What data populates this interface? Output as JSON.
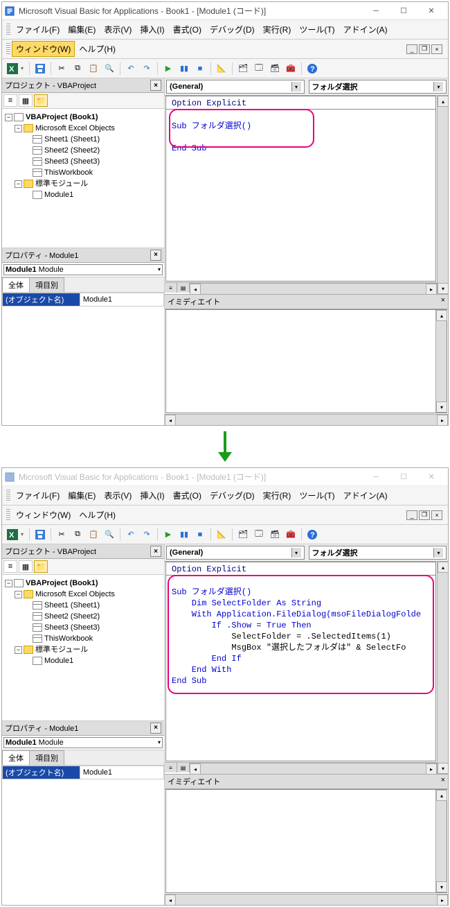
{
  "title": "Microsoft Visual Basic for Applications - Book1 - [Module1 (コード)]",
  "menu": {
    "file": "ファイル(F)",
    "edit": "編集(E)",
    "view": "表示(V)",
    "insert": "挿入(I)",
    "format": "書式(O)",
    "debug": "デバッグ(D)",
    "run": "実行(R)",
    "tools": "ツール(T)",
    "addin": "アドイン(A)",
    "window": "ウィンドウ(W)",
    "help": "ヘルプ(H)"
  },
  "project_pane_title": "プロジェクト - VBAProject",
  "tree": {
    "root": "VBAProject (Book1)",
    "excel_objects": "Microsoft Excel Objects",
    "sheet1": "Sheet1 (Sheet1)",
    "sheet2": "Sheet2 (Sheet2)",
    "sheet3": "Sheet3 (Sheet3)",
    "thiswb": "ThisWorkbook",
    "std_mod": "標準モジュール",
    "module1": "Module1"
  },
  "prop_pane_title": "プロパティ - Module1",
  "prop_combo": "Module1 Module",
  "tabs": {
    "all": "全体",
    "cat": "項目別"
  },
  "prop_key": "(オブジェクト名)",
  "prop_val": "Module1",
  "combo_left": "(General)",
  "combo_right": "フォルダ選択",
  "imm_title": "イミディエイト",
  "code1": {
    "l1": "Option Explicit",
    "l2": "Sub フォルダ選択()",
    "l3": "",
    "l4": "End Sub"
  },
  "code2": {
    "l1": "Option Explicit",
    "l2": "Sub フォルダ選択()",
    "l3": "    Dim SelectFolder As String",
    "l4": "    With Application.FileDialog(msoFileDialogFolde",
    "l5": "        If .Show = True Then",
    "l6": "            SelectFolder = .SelectedItems(1)",
    "l7": "            MsgBox \"選択したフォルダは\" & SelectFo",
    "l8": "        End If",
    "l9": "    End With",
    "l10": "End Sub"
  }
}
